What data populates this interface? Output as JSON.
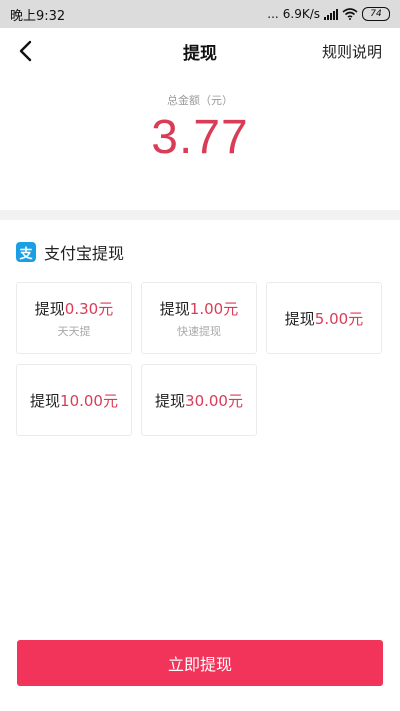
{
  "status_bar": {
    "time": "晚上9:32",
    "dots": "...",
    "net_speed": "6.9K/s",
    "battery": "74"
  },
  "nav": {
    "title": "提现",
    "rules_link": "规则说明"
  },
  "balance": {
    "label": "总金额（元）",
    "amount": "3.77"
  },
  "alipay": {
    "icon_text": "支",
    "title": "支付宝提现"
  },
  "options": [
    {
      "prefix": "提现",
      "amount": "0.30元",
      "sub": "天天提"
    },
    {
      "prefix": "提现",
      "amount": "1.00元",
      "sub": "快速提现"
    },
    {
      "prefix": "提现",
      "amount": "5.00元",
      "sub": ""
    },
    {
      "prefix": "提现",
      "amount": "10.00元",
      "sub": ""
    },
    {
      "prefix": "提现",
      "amount": "30.00元",
      "sub": ""
    }
  ],
  "submit_label": "立即提现",
  "colors": {
    "accent": "#d83c56",
    "button": "#f3345a",
    "alipay_blue": "#1a9fe4"
  }
}
